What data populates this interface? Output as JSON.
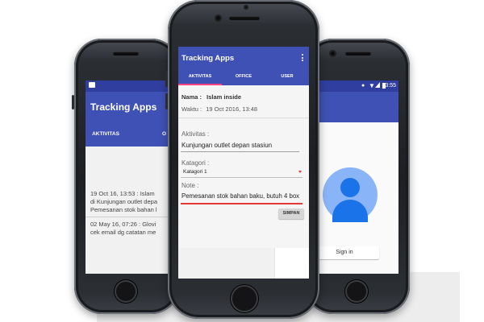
{
  "left_phone": {
    "app_title": "Tracking Apps",
    "tab_1": "AKTIVITAS",
    "tab_2_partial": "O",
    "entries": [
      "19 Oct 16, 13:53 : Islam",
      "di Kunjungan outlet depa",
      "Pemesanan stok bahan l",
      "02 May 16, 07:26 : Glovi",
      "cek email dg catatan me"
    ]
  },
  "center_phone": {
    "app_title": "Tracking Apps",
    "menu_icon": "more-vert-icon",
    "tabs": [
      "AKTIVITAS",
      "OFFICE",
      "USER"
    ],
    "nama_label": "Nama :",
    "nama_value": "Islam inside",
    "waktu_label": "Waktu :",
    "waktu_value": "19 Oct 2016, 13:48",
    "aktivitas_label": "Aktivitas :",
    "aktivitas_value": "Kunjungan outlet depan stasiun",
    "kategori_label": "Katagori :",
    "kategori_value": "Katagori 1",
    "note_label": "Note :",
    "note_value": "Pemesanan stok bahan baku, butuh 4 box",
    "save_button": "SIMPAN"
  },
  "right_phone": {
    "time": "13:55",
    "sign_in": "Sign in"
  },
  "colors": {
    "primary": "#3f51b5",
    "primary_dark": "#303f9f",
    "accent": "#ff4081",
    "error_line": "#e53935"
  }
}
